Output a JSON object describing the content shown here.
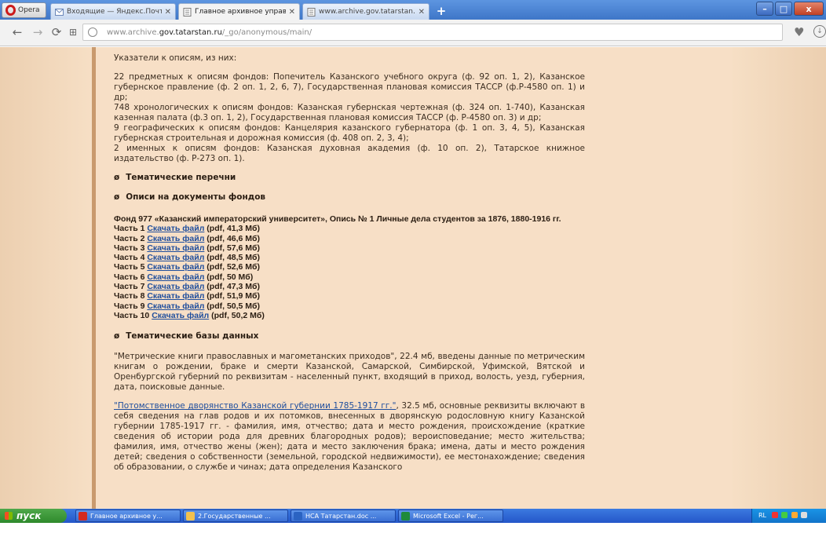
{
  "browser": {
    "opera_label": "Opera",
    "tabs": [
      {
        "label": "Входящие — Яндекс.Почта",
        "active": false
      },
      {
        "label": "Главное архивное управле",
        "active": true
      },
      {
        "label": "www.archive.gov.tatarstan.",
        "active": false
      }
    ],
    "close_glyph": "✕",
    "new_tab_glyph": "+",
    "window_controls": {
      "minimize": "–",
      "maximize": "□",
      "close": "x"
    }
  },
  "address": {
    "prefix": "www.archive.",
    "domain": "gov.tatarstan.ru",
    "path": "/_go/anonymous/main/"
  },
  "content": {
    "intro_heading": "Указатели к описям, из них:",
    "index_paragraphs": [
      "22 предметных к описям фондов: Попечитель Казанского учебного округа (ф. 92 оп. 1, 2), Казанское губернское правление (ф. 2 оп. 1, 2, 6, 7), Государственная плановая комиссия ТАССР (ф.Р-4580 оп. 1) и др;",
      "748 хронологических к описям фондов: Казанская губернская чертежная (ф. 324 оп. 1-740), Казанская казенная палата (ф.3 оп. 1, 2), Государственная плановая комиссия ТАССР (ф. Р-4580 оп. 3) и др;",
      "9 географических к описям фондов: Канцелярия казанского губернатора (ф. 1 оп. 3, 4, 5), Казанская губернская строительная и дорожная комиссия (ф. 408 оп. 2, 3, 4);",
      "2 именных к описям фондов: Казанская духовная академия (ф. 10 оп. 2), Татарское книжное издательство (ф. Р-273 оп. 1)."
    ],
    "section_bullet": "ø",
    "section_thematic_lists": "Тематические перечни",
    "section_inventories": "Описи на документы фондов",
    "fond_title": "Фонд 977 «Казанский императорский университет», Опись № 1 Личные дела студентов за 1876, 1880-1916 гг.",
    "download_link_text": "Скачать файл",
    "parts": [
      {
        "label": "Часть 1",
        "info": "(pdf, 41,3 Мб)"
      },
      {
        "label": "Часть 2",
        "info": "(pdf, 46,6 Мб)"
      },
      {
        "label": "Часть 3",
        "info": "(pdf, 57,6 Мб)"
      },
      {
        "label": "Часть 4",
        "info": "(pdf, 48,5 Мб)"
      },
      {
        "label": "Часть 5",
        "info": "(pdf, 52,6 Мб)"
      },
      {
        "label": "Часть 6",
        "info": "(pdf, 50 Мб)"
      },
      {
        "label": "Часть 7",
        "info": "(pdf, 47,3 Мб)"
      },
      {
        "label": "Часть 8",
        "info": "(pdf, 51,9 Мб)"
      },
      {
        "label": "Часть 9",
        "info": "(pdf, 50,5 Мб)"
      },
      {
        "label": "Часть 10",
        "info": "(pdf, 50,2 Мб)"
      }
    ],
    "section_databases": "Тематические базы данных",
    "db1_text": "\"Метрические книги православных и магометанских приходов\",   22.4 мб, введены данные по метрическим книгам о рождении, браке и смерти Казанской, Самарской, Симбирской, Уфимской, Вятской и Оренбургской губерний по реквизитам - населенный пункт, входящий в приход, волость, уезд, губерния, дата, поисковые данные.",
    "db2_link": "\"Потомственное дворянство Казанской губернии 1785-1917 гг.\"",
    "db2_text": ",   32.5 мб, основные реквизиты включают в себя сведения на глав родов и их потомков, внесенных в дворянскую родословную книгу Казанской губернии 1785-1917 гг. - фамилия, имя, отчество; дата и место рождения, происхождение (краткие сведения об истории рода для древних благородных родов); вероисповедание; место жительства; фамилия, имя, отчество жены (жен); дата и место заключения брака; имена, даты и место рождения детей; сведения о собственности (земельной, городской недвижимости), ее местонахождение; сведения об образовании, о службе и чинах; дата определения Казанского"
  },
  "taskbar": {
    "start_label": "пуск",
    "tasks": [
      {
        "label": "Главное архивное у...",
        "icon_color": "#d42a1f"
      },
      {
        "label": "2.Государственные ...",
        "icon_color": "#f2c14e"
      },
      {
        "label": "НСА Татарстан.doc ...",
        "icon_color": "#2b63c2"
      },
      {
        "label": "Microsoft Excel - Рег...",
        "icon_color": "#1f8a3b"
      }
    ],
    "tray_lang": "RL",
    "clock": "16:33"
  }
}
